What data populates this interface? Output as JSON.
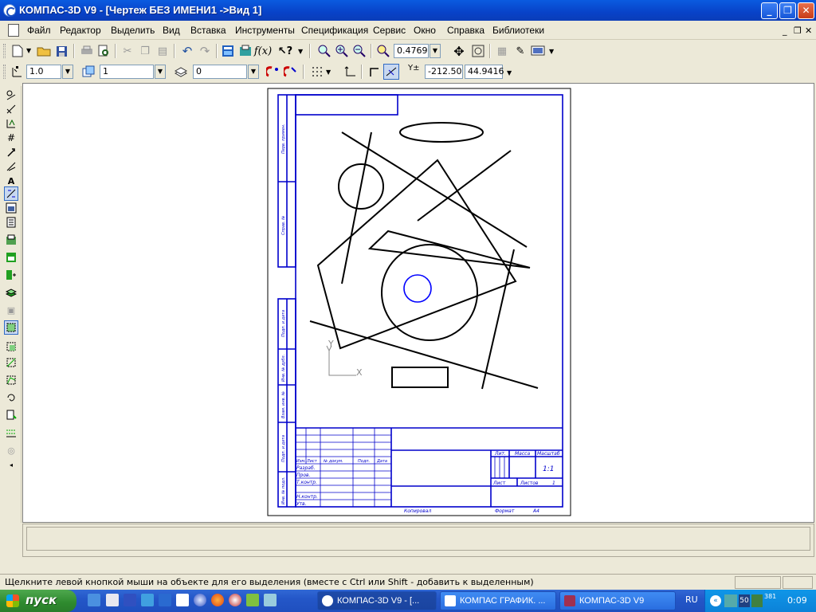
{
  "window": {
    "title": "КОМПАС-3D V9 - [Чертеж БЕЗ ИМЕНИ1 ->Вид 1]",
    "minimize": "_",
    "maximize": "❐",
    "close": "✕"
  },
  "menu": {
    "items": [
      "Файл",
      "Редактор",
      "Выделить",
      "Вид",
      "Вставка",
      "Инструменты",
      "Спецификация",
      "Сервис",
      "Окно",
      "Справка",
      "Библиотеки"
    ],
    "mdi_controls": [
      "_",
      "❐",
      "✕"
    ]
  },
  "toolbar_standard": {
    "zoom_value": "0.4769"
  },
  "toolbar_current": {
    "style_value": "1.0",
    "view_value": "1",
    "layer_value": "0",
    "coord_label": "Y±",
    "coord_x": "-212.50",
    "coord_y": "44.9416"
  },
  "drawing": {
    "axis_y_label": "Y",
    "axis_x_label": "X",
    "stamp": {
      "lit_label": "Лит.",
      "mass_label": "Масса",
      "scale_label": "Масштаб",
      "scale_value": "1:1",
      "sheet_label": "Лист",
      "sheets_label": "Листов",
      "sheets_value": "1",
      "izm_label": "Изм.",
      "list_label": "Лист",
      "doc_label": "№ докум.",
      "sign_label": "Подп.",
      "date_label": "Дата",
      "razrab_label": "Разраб.",
      "prov_label": "Пров.",
      "tkontr_label": "Т.контр.",
      "nkontr_label": "Н.контр.",
      "utv_label": "Утв.",
      "copied_label": "Копировал",
      "format_label": "Формат",
      "format_value": "A4"
    },
    "side_labels": [
      "Перв. примен.",
      "Справ. №",
      "Подп. и дата",
      "Инв. № дубл.",
      "Взам. инв. №",
      "Подп. и дата",
      "Инв. № подл."
    ]
  },
  "status": {
    "message": "Щелкните левой кнопкой мыши на объекте для его выделения (вместе с Ctrl или Shift - добавить к выделенным)"
  },
  "taskbar": {
    "start_label": "пуск",
    "tasks": [
      {
        "label": "КОМПАС-3D V9 - [..."
      },
      {
        "label": "КОМПАС ГРАФИК. ..."
      },
      {
        "label": "КОМПАС-3D V9"
      }
    ],
    "lang": "RU",
    "tray_badge": "50",
    "tray_num": "381",
    "clock": "0:09"
  },
  "colors": {
    "titlebar": "#0842c8",
    "frame_blue": "#0000cc",
    "geometry": "#000000",
    "selection": "#0000ff"
  }
}
